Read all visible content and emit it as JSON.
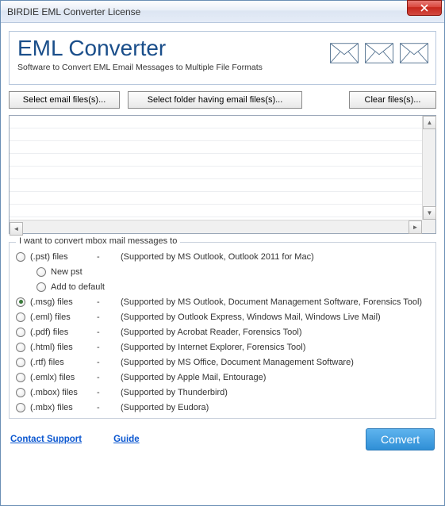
{
  "window": {
    "title": "BIRDIE EML Converter License"
  },
  "header": {
    "title": "EML Converter",
    "subtitle": "Software to Convert EML Email Messages to Multiple File Formats"
  },
  "buttons": {
    "select_files": "Select email files(s)...",
    "select_folder": "Select folder having email files(s)...",
    "clear": "Clear files(s)..."
  },
  "group_label": "I want to convert mbox mail messages to",
  "options": [
    {
      "label": "(.pst) files",
      "desc": "(Supported by MS Outlook, Outlook 2011 for Mac)",
      "selected": false,
      "sub": [
        {
          "label": "New pst"
        },
        {
          "label": "Add to default"
        }
      ]
    },
    {
      "label": "(.msg) files",
      "desc": "(Supported by MS Outlook, Document Management Software, Forensics Tool)",
      "selected": true
    },
    {
      "label": "(.eml) files",
      "desc": "(Supported by Outlook Express,  Windows Mail, Windows Live Mail)",
      "selected": false
    },
    {
      "label": "(.pdf) files",
      "desc": "(Supported by Acrobat Reader, Forensics Tool)",
      "selected": false
    },
    {
      "label": "(.html) files",
      "desc": "(Supported by Internet Explorer, Forensics Tool)",
      "selected": false
    },
    {
      "label": "(.rtf) files",
      "desc": "(Supported by MS Office, Document Management Software)",
      "selected": false
    },
    {
      "label": "(.emlx) files",
      "desc": "(Supported by Apple Mail, Entourage)",
      "selected": false
    },
    {
      "label": "(.mbox) files",
      "desc": "(Supported by Thunderbird)",
      "selected": false
    },
    {
      "label": "(.mbx) files",
      "desc": "(Supported by Eudora)",
      "selected": false
    }
  ],
  "footer": {
    "contact": "Contact Support",
    "guide": "Guide",
    "convert": "Convert"
  }
}
